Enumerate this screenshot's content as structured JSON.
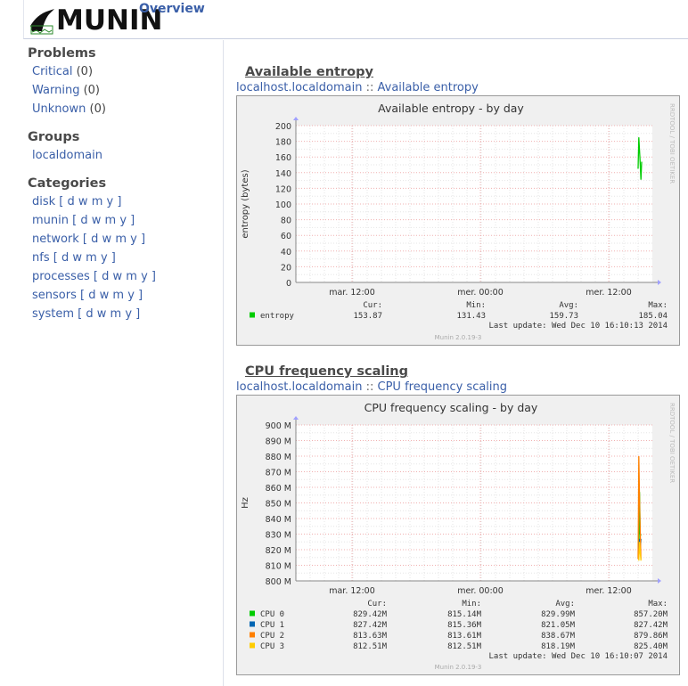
{
  "header": {
    "logo_text": "MUNIN",
    "overview_label": "Overview"
  },
  "sidebar": {
    "problems_title": "Problems",
    "problems": [
      {
        "label": "Critical",
        "count": "(0)"
      },
      {
        "label": "Warning",
        "count": "(0)"
      },
      {
        "label": "Unknown",
        "count": "(0)"
      }
    ],
    "groups_title": "Groups",
    "groups": [
      "localdomain"
    ],
    "categories_title": "Categories",
    "categories": [
      "disk",
      "munin",
      "network",
      "nfs",
      "processes",
      "sensors",
      "system"
    ],
    "periods": [
      "d",
      "w",
      "m",
      "y"
    ]
  },
  "graphs": [
    {
      "section_title": "Available entropy",
      "crumb_host": "localhost.localdomain",
      "crumb_sep": "::",
      "crumb_plugin": "Available entropy",
      "chart_title": "Available entropy - by day",
      "ylabel": "entropy (bytes)",
      "side_text": "RRDTOOL / TOBI OETIKER",
      "x_ticks": [
        "mar. 12:00",
        "mer. 00:00",
        "mer. 12:00"
      ],
      "y_ticks": [
        "200",
        "180",
        "160",
        "140",
        "120",
        "100",
        "80",
        "60",
        "40",
        "20",
        "0"
      ],
      "stat_headers": [
        "Cur:",
        "Min:",
        "Avg:",
        "Max:"
      ],
      "series": [
        {
          "name": "entropy",
          "color": "#00cc00",
          "cur": "153.87",
          "min": "131.43",
          "avg": "159.73",
          "max": "185.04"
        }
      ],
      "last_update": "Last update:  Wed Dec 10 16:10:13 2014",
      "footer": "Munin 2.0.19-3"
    },
    {
      "section_title": "CPU frequency scaling",
      "crumb_host": "localhost.localdomain",
      "crumb_sep": "::",
      "crumb_plugin": "CPU frequency scaling",
      "chart_title": "CPU frequency scaling - by day",
      "ylabel": "Hz",
      "side_text": "RRDTOOL / TOBI OETIKER",
      "x_ticks": [
        "mar. 12:00",
        "mer. 00:00",
        "mer. 12:00"
      ],
      "y_ticks": [
        "900 M",
        "890 M",
        "880 M",
        "870 M",
        "860 M",
        "850 M",
        "840 M",
        "830 M",
        "820 M",
        "810 M",
        "800 M"
      ],
      "stat_headers": [
        "Cur:",
        "Min:",
        "Avg:",
        "Max:"
      ],
      "series": [
        {
          "name": "CPU 0",
          "color": "#00cc00",
          "cur": "829.42M",
          "min": "815.14M",
          "avg": "829.99M",
          "max": "857.20M"
        },
        {
          "name": "CPU 1",
          "color": "#0066b3",
          "cur": "827.42M",
          "min": "815.36M",
          "avg": "821.05M",
          "max": "827.42M"
        },
        {
          "name": "CPU 2",
          "color": "#ff8000",
          "cur": "813.63M",
          "min": "813.61M",
          "avg": "838.67M",
          "max": "879.86M"
        },
        {
          "name": "CPU 3",
          "color": "#ffcc00",
          "cur": "812.51M",
          "min": "812.51M",
          "avg": "818.19M",
          "max": "825.40M"
        }
      ],
      "last_update": "Last update:  Wed Dec 10 16:10:07 2014",
      "footer": "Munin 2.0.19-3"
    }
  ],
  "chart_data": [
    {
      "type": "line",
      "title": "Available entropy - by day",
      "xlabel": "",
      "ylabel": "entropy (bytes)",
      "ylim": [
        0,
        200
      ],
      "x": [
        "mar. 12:00",
        "mer. 00:00",
        "mer. 12:00"
      ],
      "series": [
        {
          "name": "entropy",
          "points": [
            [
              0.96,
              145
            ],
            [
              0.962,
              185
            ],
            [
              0.965,
              160
            ],
            [
              0.968,
              131
            ],
            [
              0.97,
              154
            ]
          ]
        }
      ],
      "grid": true,
      "legend": "bottom-left"
    },
    {
      "type": "line",
      "title": "CPU frequency scaling - by day",
      "xlabel": "",
      "ylabel": "Hz",
      "ylim": [
        800,
        900
      ],
      "x": [
        "mar. 12:00",
        "mer. 00:00",
        "mer. 12:00"
      ],
      "series": [
        {
          "name": "CPU 0",
          "points": [
            [
              0.962,
              816
            ],
            [
              0.964,
              857
            ],
            [
              0.966,
              830
            ],
            [
              0.968,
              829
            ]
          ]
        },
        {
          "name": "CPU 1",
          "points": [
            [
              0.962,
              816
            ],
            [
              0.964,
              827
            ],
            [
              0.966,
              820
            ],
            [
              0.968,
              827
            ]
          ]
        },
        {
          "name": "CPU 2",
          "points": [
            [
              0.96,
              814
            ],
            [
              0.962,
              880
            ],
            [
              0.965,
              840
            ],
            [
              0.968,
              814
            ]
          ]
        },
        {
          "name": "CPU 3",
          "points": [
            [
              0.962,
              813
            ],
            [
              0.964,
              825
            ],
            [
              0.966,
              818
            ],
            [
              0.968,
              813
            ]
          ]
        }
      ],
      "grid": true,
      "legend": "bottom-left"
    }
  ]
}
